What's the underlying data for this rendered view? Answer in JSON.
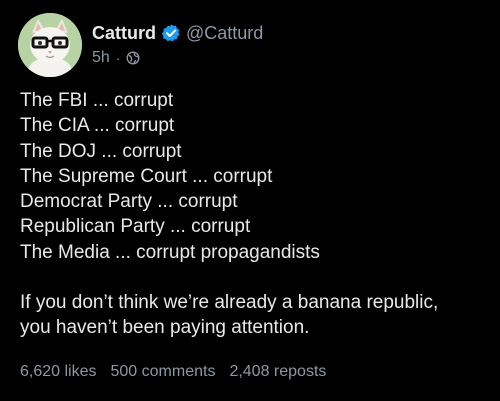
{
  "author": {
    "display_name": "Catturd",
    "handle": "@Catturd",
    "time": "5h",
    "separator": "·",
    "visibility_icon": "globe-icon",
    "verified_icon": "verified-badge-icon",
    "verified_color": "#1d9bf0",
    "avatar_icon": "cat-with-glasses-avatar"
  },
  "post": {
    "lines": [
      "The FBI ... corrupt",
      "The CIA ... corrupt",
      "The DOJ ... corrupt",
      "The Supreme Court ... corrupt",
      "Democrat Party ... corrupt",
      "Republican Party ... corrupt",
      "The Media ... corrupt propagandists"
    ],
    "closing_lines": [
      "If you don’t think we’re already a banana republic,",
      "you haven’t been paying attention."
    ]
  },
  "stats": {
    "likes": "6,620 likes",
    "comments": "500 comments",
    "reposts": "2,408 reposts"
  },
  "colors": {
    "background": "#000000",
    "text": "#e7e9ea",
    "muted": "#8b98a5"
  }
}
